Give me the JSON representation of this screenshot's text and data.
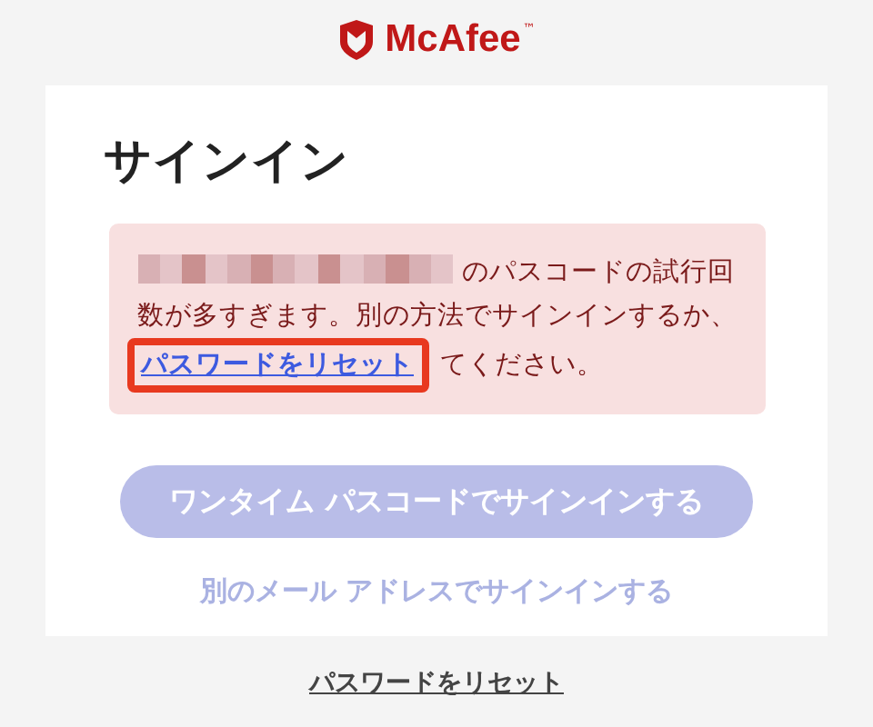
{
  "logo": {
    "name": "McAfee",
    "mark": "™"
  },
  "card": {
    "title": "サインイン",
    "alert": {
      "before": "のパスコードの試行回数が多すぎます。別の方法でサインインするか、",
      "link": {
        "label": "パスワードをリセット",
        "highlighted": true
      },
      "after": "てください。"
    },
    "primary_button": {
      "label": "ワンタイム パスコードでサインインする",
      "disabled": true
    },
    "secondary_link": {
      "label": "別のメール アドレスでサインインする",
      "disabled": true
    }
  },
  "footer_link": "パスワードをリセット"
}
